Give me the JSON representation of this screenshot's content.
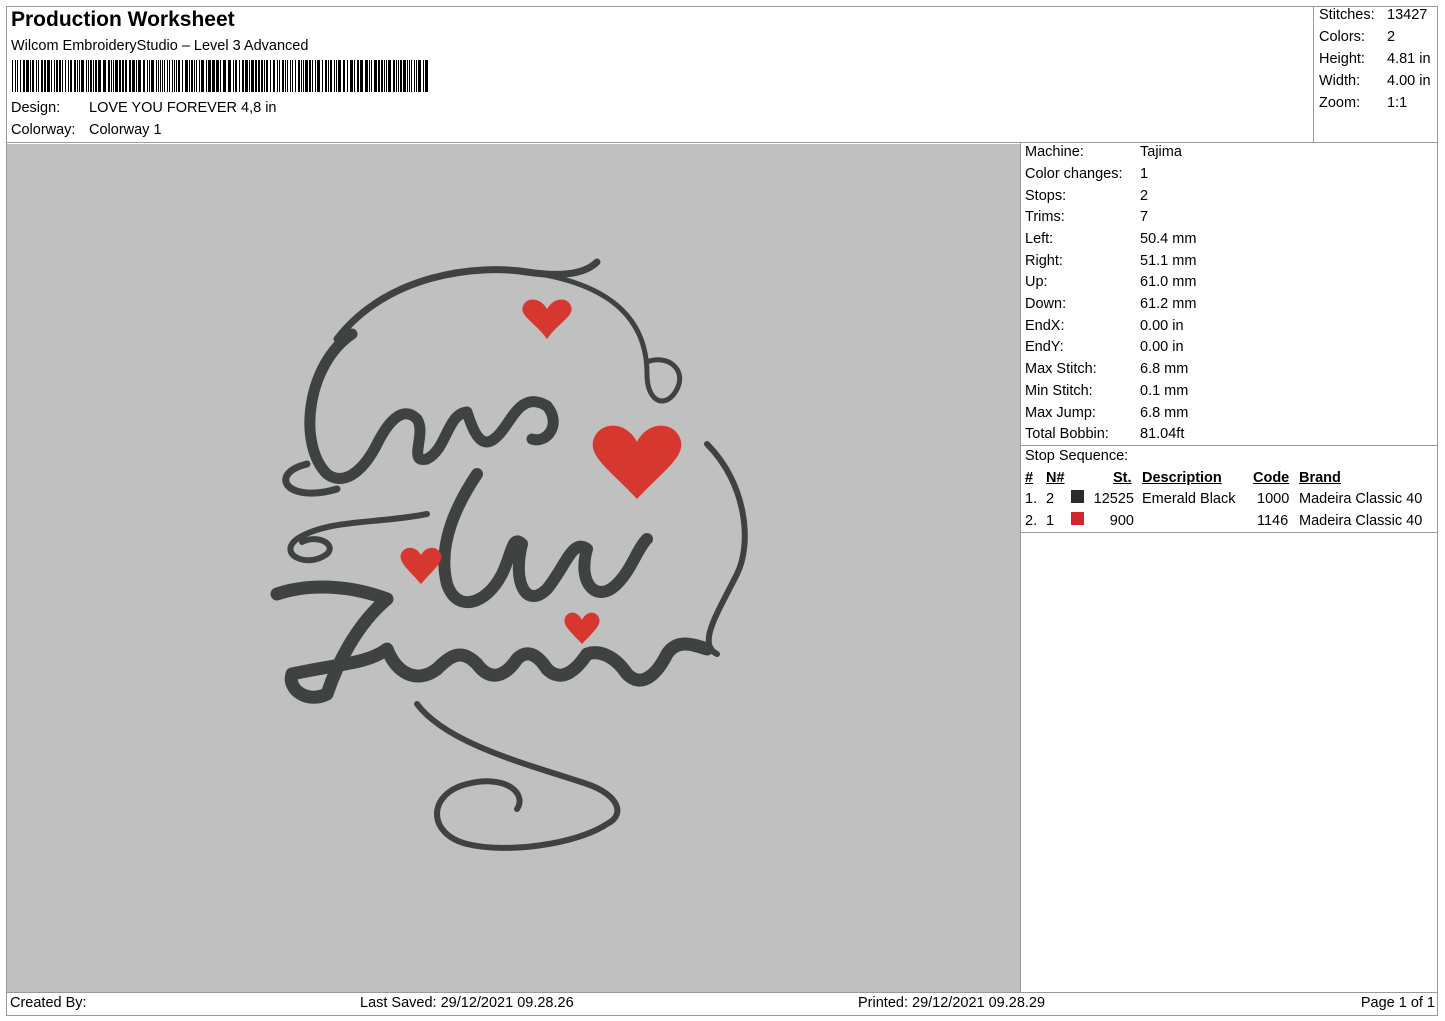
{
  "header": {
    "title": "Production Worksheet",
    "subtitle": "Wilcom EmbroideryStudio – Level 3 Advanced",
    "design_label": "Design:",
    "design_value": "LOVE YOU FOREVER 4,8 in",
    "colorway_label": "Colorway:",
    "colorway_value": "Colorway 1"
  },
  "summary": [
    {
      "label": "Stitches:",
      "value": "13427"
    },
    {
      "label": "Colors:",
      "value": "2"
    },
    {
      "label": "Height:",
      "value": "4.81 in"
    },
    {
      "label": "Width:",
      "value": "4.00 in"
    },
    {
      "label": "Zoom:",
      "value": "1:1"
    }
  ],
  "machine_info": [
    {
      "label": "Machine:",
      "value": "Tajima"
    },
    {
      "label": "Color changes:",
      "value": "1"
    },
    {
      "label": "Stops:",
      "value": "2"
    },
    {
      "label": "Trims:",
      "value": "7"
    },
    {
      "label": "Left:",
      "value": "50.4 mm"
    },
    {
      "label": "Right:",
      "value": "51.1 mm"
    },
    {
      "label": "Up:",
      "value": "61.0 mm"
    },
    {
      "label": "Down:",
      "value": "61.2 mm"
    },
    {
      "label": "EndX:",
      "value": "0.00 in"
    },
    {
      "label": "EndY:",
      "value": "0.00 in"
    },
    {
      "label": "Max Stitch:",
      "value": "6.8 mm"
    },
    {
      "label": "Min Stitch:",
      "value": "0.1 mm"
    },
    {
      "label": "Max Jump:",
      "value": "6.8 mm"
    },
    {
      "label": "Total Bobbin:",
      "value": "81.04ft"
    }
  ],
  "stop_sequence": {
    "title": "Stop Sequence:",
    "columns": [
      "#",
      "N#",
      "St.",
      "Description",
      "Code",
      "Brand"
    ],
    "rows": [
      {
        "num": "1.",
        "n": "2",
        "color": "#2b2b2b",
        "st": "12525",
        "description": "Emerald Black",
        "code": "1000",
        "brand": "Madeira Classic 40"
      },
      {
        "num": "2.",
        "n": "1",
        "color": "#d0262d",
        "st": "900",
        "description": "",
        "code": "1146",
        "brand": "Madeira Classic 40"
      }
    ]
  },
  "design_preview": {
    "thread_colors": {
      "black": "#3f433f",
      "red": "#d6372f"
    }
  },
  "footer": {
    "created_by": "Created By:",
    "last_saved": "Last Saved: 29/12/2021 09.28.26",
    "printed": "Printed: 29/12/2021 09.28.29",
    "page": "Page 1 of 1"
  }
}
